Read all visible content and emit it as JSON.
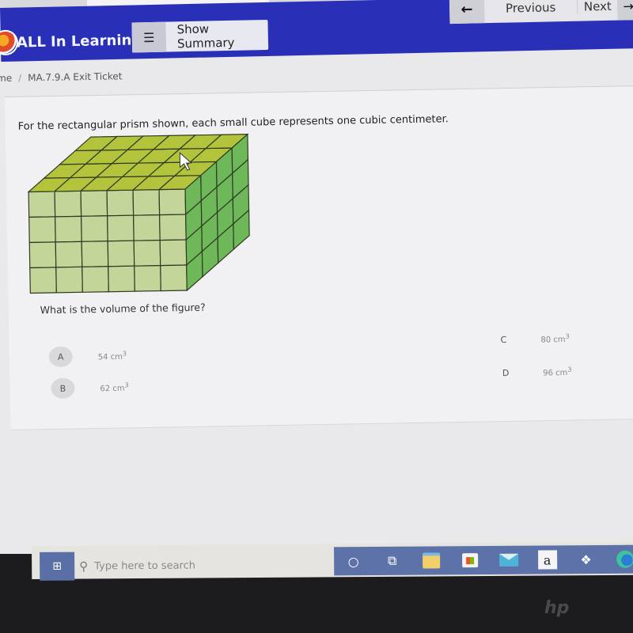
{
  "app": {
    "brand": "ALL In Learning",
    "show_summary_label": "Show Summary",
    "previous_label": "Previous",
    "next_label": "Next"
  },
  "breadcrumb": {
    "home": "me",
    "separator": "/",
    "current": "MA.7.9.A Exit Ticket"
  },
  "question": {
    "text": "For the rectangular prism shown, each small cube represents one cubic centimeter.",
    "prompt": "What is the volume of the figure?",
    "figure": {
      "front_columns": 6,
      "front_rows": 4,
      "depth": 4,
      "colors": {
        "front": "#c4d59a",
        "top": "#b3c43c",
        "side": "#6fb85a",
        "lines": "#2e3a22"
      }
    },
    "choices": [
      {
        "letter": "A",
        "value": "54 cm",
        "exp": "3"
      },
      {
        "letter": "B",
        "value": "62 cm",
        "exp": "3"
      },
      {
        "letter": "C",
        "value": "80 cm",
        "exp": "3"
      },
      {
        "letter": "D",
        "value": "96 cm",
        "exp": "3"
      }
    ]
  },
  "taskbar": {
    "search_placeholder": "Type here to search",
    "apps": [
      "cortana",
      "task-view",
      "file-explorer",
      "microsoft-store",
      "mail",
      "amazon",
      "dropbox",
      "edge"
    ],
    "amazon_glyph": "a"
  },
  "device": {
    "logo": "hp"
  }
}
